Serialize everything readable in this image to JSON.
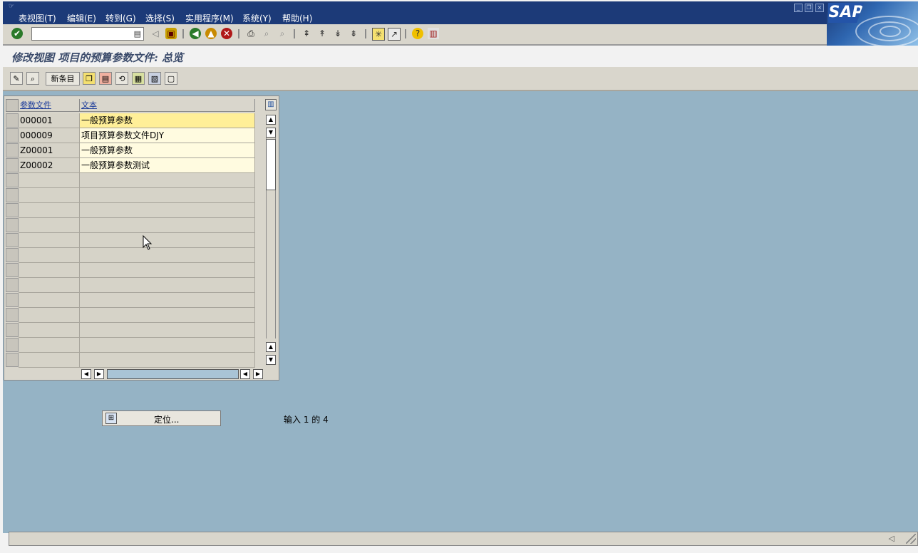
{
  "menubar": {
    "items": [
      "表视图(T)",
      "编辑(E)",
      "转到(G)",
      "选择(S)",
      "实用程序(M)",
      "系统(Y)",
      "帮助(H)"
    ],
    "brand": "SAP"
  },
  "toolbar": {
    "command_field_value": ""
  },
  "page": {
    "title": "修改视图 项目的预算参数文件: 总览"
  },
  "app_toolbar": {
    "new_entries_label": "新条目"
  },
  "table": {
    "columns": [
      "参数文件",
      "文本"
    ],
    "rows": [
      {
        "profile": "000001",
        "text": "一般预算参数"
      },
      {
        "profile": "000009",
        "text": "项目预算参数文件DJY"
      },
      {
        "profile": "Z00001",
        "text": "一般预算参数"
      },
      {
        "profile": "Z00002",
        "text": "一般预算参数测试"
      }
    ],
    "empty_rows": 13
  },
  "position_button": {
    "label": "定位..."
  },
  "entry_info": "输入 1 的 4",
  "colors": {
    "menubar": "#1c3a78",
    "workspace": "#95b3c5",
    "highlight_row": "#ffef98",
    "input_row": "#fffbe0"
  }
}
